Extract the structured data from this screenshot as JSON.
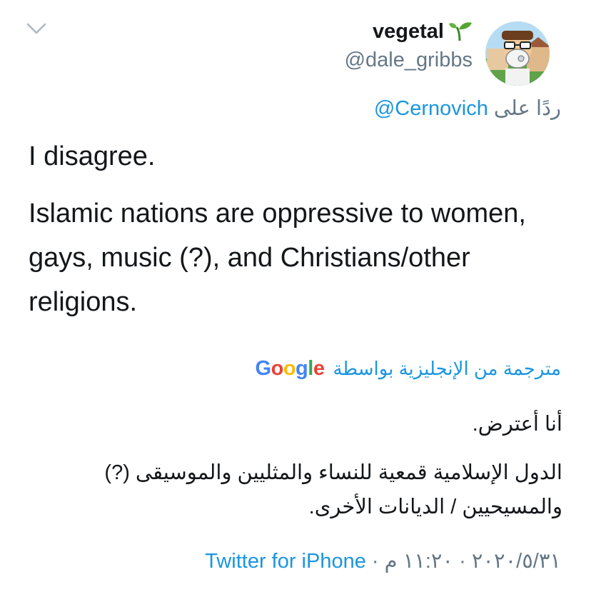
{
  "tweet": {
    "display_name": "vegetal",
    "name_emoji": "seedling-icon",
    "handle": "@dale_gribbs",
    "reply_prefix": "ردًا على",
    "reply_mention": "@Cernovich",
    "text_paragraphs": [
      "I disagree.",
      "Islamic nations are oppressive to women, gays, music (?), and Christians/other religions."
    ],
    "translated_by_label": "مترجمة من الإنجليزية بواسطة",
    "translation_provider": "Google",
    "translation_paragraphs": [
      "أنا أعترض.",
      "الدول الإسلامية قمعية للنساء والمثليين والموسيقى (?) والمسيحيين / الديانات الأخرى."
    ],
    "date": "٢٠٢٠/٥/٣١",
    "time": "١١:٢٠ م",
    "source": "Twitter for iPhone",
    "separator": "·"
  },
  "colors": {
    "text_primary": "#14171a",
    "text_secondary": "#657786",
    "link": "#1b95e0"
  }
}
